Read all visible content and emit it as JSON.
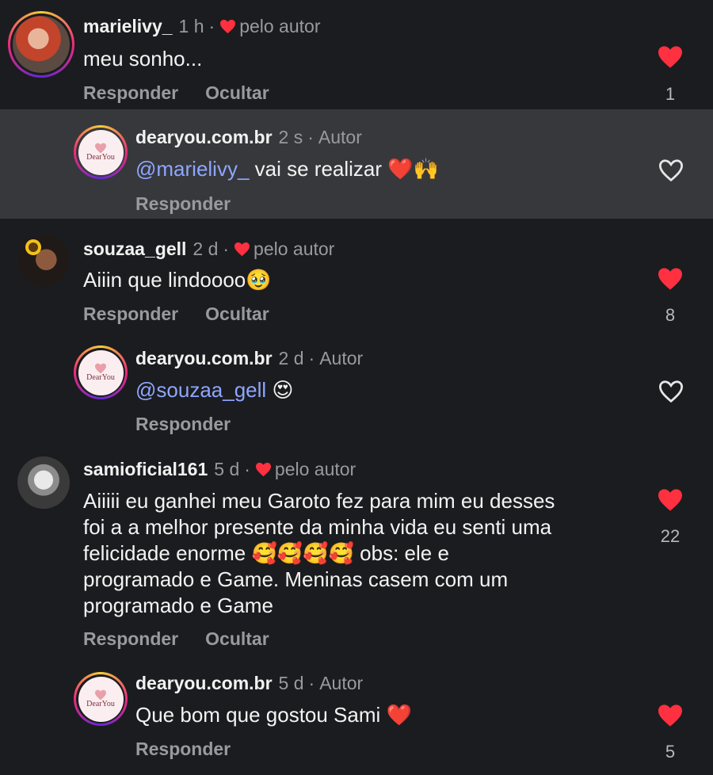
{
  "comments": [
    {
      "username": "marielivy_",
      "time": "1 h",
      "liked_label": "pelo autor",
      "text": "meu sonho...",
      "reply_label": "Responder",
      "hide_label": "Ocultar",
      "like_count": "1",
      "liked": true
    },
    {
      "username": "dearyou.com.br",
      "time": "2 s",
      "author_label": "Autor",
      "mention": "@marielivy_",
      "text": " vai se realizar ❤️🙌",
      "reply_label": "Responder",
      "liked": false
    },
    {
      "username": "souzaa_gell",
      "time": "2 d",
      "liked_label": "pelo autor",
      "text": "Aiiin que lindoooo🥹",
      "reply_label": "Responder",
      "hide_label": "Ocultar",
      "like_count": "8",
      "liked": true
    },
    {
      "username": "dearyou.com.br",
      "time": "2 d",
      "author_label": "Autor",
      "mention": "@souzaa_gell",
      "text": " 😍",
      "reply_label": "Responder",
      "liked": false
    },
    {
      "username": "samioficial161",
      "time": "5 d",
      "liked_label": "pelo autor",
      "text_lines": [
        "Aiiiii eu ganhei meu Garoto fez para mim eu desses",
        "foi a a melhor presente da minha vida eu senti uma",
        "felicidade enorme 🥰🥰🥰🥰 obs: ele e",
        "programado e Game. Meninas casem com um",
        "programado e Game"
      ],
      "reply_label": "Responder",
      "hide_label": "Ocultar",
      "like_count": "22",
      "liked": true
    },
    {
      "username": "dearyou.com.br",
      "time": "5 d",
      "author_label": "Autor",
      "text": "Que bom que gostou Sami ❤️",
      "reply_label": "Responder",
      "like_count": "5",
      "liked": true
    }
  ],
  "brand_avatar_text": "DearYou",
  "colors": {
    "like_red": "#ff3040",
    "mention_blue": "#8ea6ff",
    "muted": "#9a9a9e",
    "highlight_bg": "#37383c"
  }
}
